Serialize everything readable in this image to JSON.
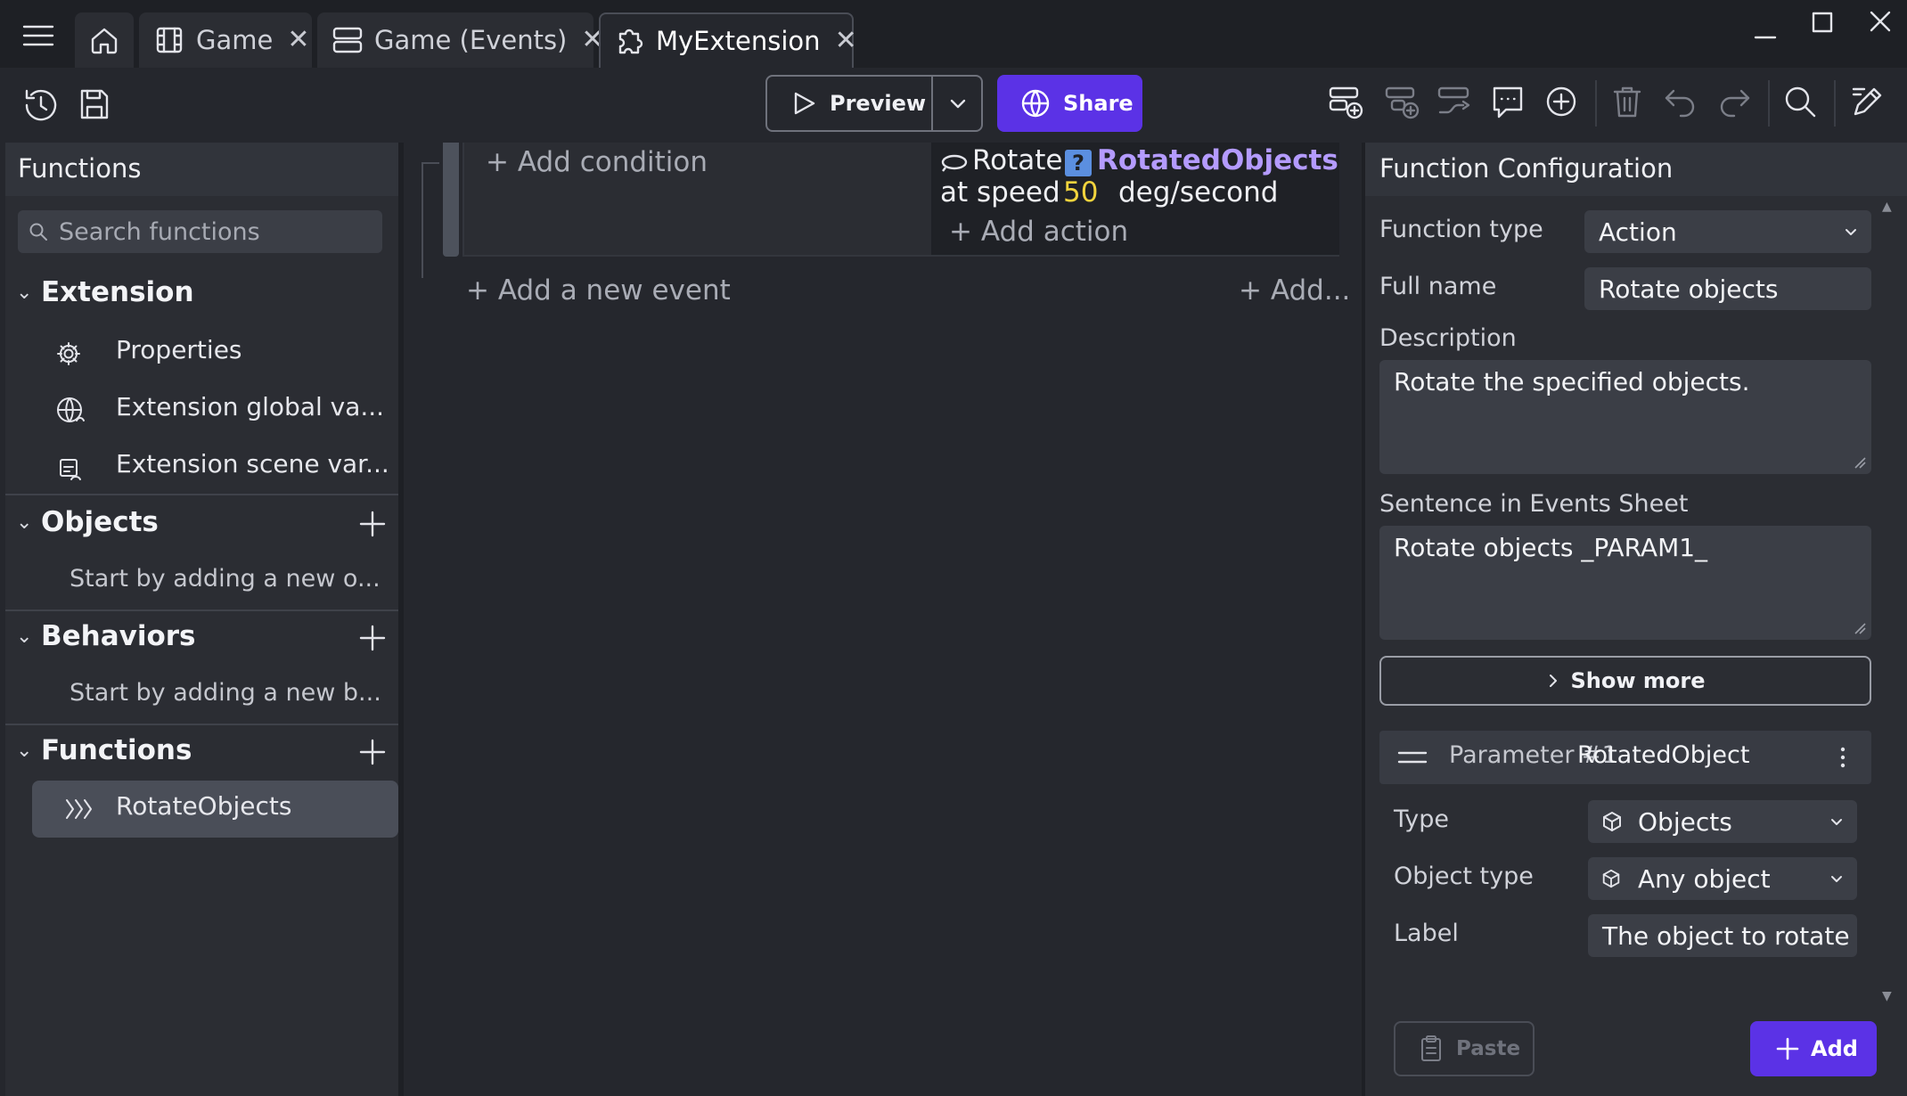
{
  "tabs": [
    {
      "label": "Game"
    },
    {
      "label": "Game (Events)"
    },
    {
      "label": "MyExtension"
    }
  ],
  "toolbar": {
    "preview_label": "Preview",
    "share_label": "Share"
  },
  "left_panel": {
    "title": "Functions",
    "search_placeholder": "Search functions",
    "sections": {
      "extension": {
        "title": "Extension",
        "items": [
          "Properties",
          "Extension global va...",
          "Extension scene var..."
        ]
      },
      "objects": {
        "title": "Objects",
        "empty": "Start by adding a new o..."
      },
      "behaviors": {
        "title": "Behaviors",
        "empty": "Start by adding a new b..."
      },
      "functions": {
        "title": "Functions",
        "items": [
          "RotateObjects"
        ]
      }
    }
  },
  "events": {
    "add_condition": "+ Add condition",
    "action_verb": "Rotate",
    "action_object": "RotatedObjects",
    "action_speed_prefix": "at speed",
    "action_speed_value": "50",
    "action_speed_unit": "deg/second",
    "add_action": "+ Add action",
    "add_event": "+ Add a new event",
    "add_other": "+ Add..."
  },
  "right_panel": {
    "title": "Function Configuration",
    "function_type_label": "Function type",
    "function_type_value": "Action",
    "full_name_label": "Full name",
    "full_name_value": "Rotate objects",
    "description_label": "Description",
    "description_value": "Rotate the specified objects.",
    "sentence_label": "Sentence in Events Sheet",
    "sentence_value": "Rotate objects _PARAM1_",
    "show_more_label": "Show more",
    "parameter": {
      "header": "Parameter #1",
      "name": "RotatedObject",
      "type_label": "Type",
      "type_value": "Objects",
      "object_type_label": "Object type",
      "object_type_value": "Any object",
      "label_label": "Label",
      "label_value": "The object to rotate"
    },
    "paste_label": "Paste",
    "add_label": "Add"
  },
  "colors": {
    "accent": "#5b32e6",
    "object_highlight": "#b49bff",
    "number_highlight": "#f2d43d"
  }
}
